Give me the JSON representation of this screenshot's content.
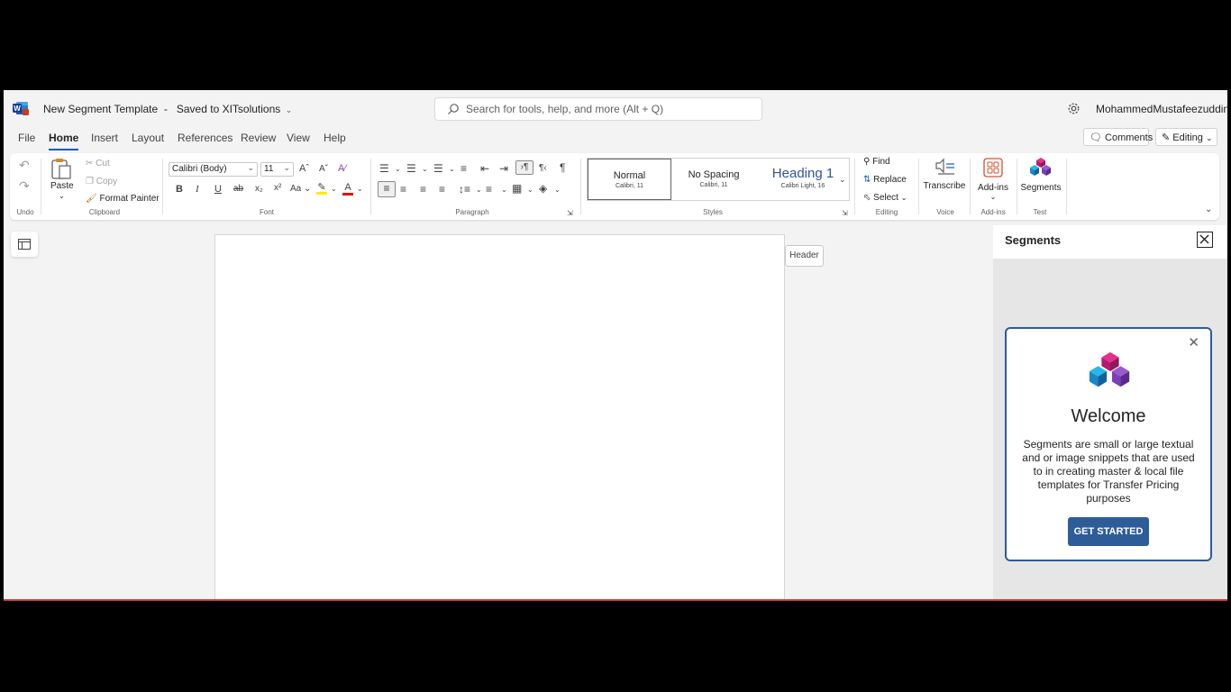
{
  "title_bar": {
    "document_title": "New Segment Template",
    "save_status": "Saved to XITsolutions",
    "search_placeholder": "Search for tools, help, and more (Alt + Q)",
    "user_name": "MohammedMustafeezuddin"
  },
  "tabs": [
    "File",
    "Home",
    "Insert",
    "Layout",
    "References",
    "Review",
    "View",
    "Help"
  ],
  "active_tab": "Home",
  "top_right": {
    "comments": "Comments",
    "editing": "Editing"
  },
  "ribbon": {
    "undo_group": "Undo",
    "clipboard": {
      "paste": "Paste",
      "cut": "Cut",
      "copy": "Copy",
      "format_painter": "Format Painter",
      "label": "Clipboard"
    },
    "font": {
      "name": "Calibri (Body)",
      "size": "11",
      "label": "Font",
      "bold": "B",
      "italic": "I",
      "underline": "U",
      "strike": "ab",
      "change_case": "Aa"
    },
    "paragraph": {
      "label": "Paragraph"
    },
    "styles": {
      "items": [
        {
          "name": "Normal",
          "sub": "Calibri, 11"
        },
        {
          "name": "No Spacing",
          "sub": "Calibri, 11"
        },
        {
          "name": "Heading 1",
          "sub": "Calibri Light, 16"
        }
      ],
      "label": "Styles"
    },
    "editing": {
      "find": "Find",
      "replace": "Replace",
      "select": "Select",
      "label": "Editing"
    },
    "voice": {
      "transcribe": "Transcribe",
      "label": "Voice"
    },
    "addins": {
      "button": "Add-ins",
      "label": "Add-ins"
    },
    "test": {
      "segments": "Segments",
      "label": "Test"
    }
  },
  "canvas": {
    "header_tip": "Header"
  },
  "task_pane": {
    "title": "Segments",
    "welcome": "Welcome",
    "description": "Segments are small or large textual and or image snippets that are used to in creating master & local file templates for Transfer Pricing purposes",
    "button": "GET STARTED"
  },
  "colors": {
    "accent": "#185abd",
    "pane_button": "#2d5c99",
    "app_bg": "#f3f3f3"
  }
}
